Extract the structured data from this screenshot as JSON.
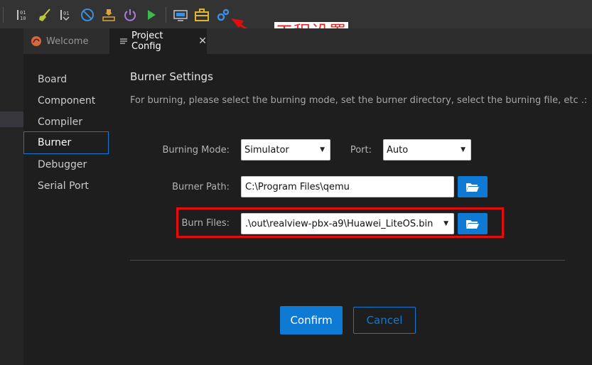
{
  "toolbar": {
    "items": [
      {
        "name": "build-icon"
      },
      {
        "name": "clean-icon"
      },
      {
        "name": "rebuild-icon"
      },
      {
        "name": "stop-icon"
      },
      {
        "name": "burn-icon"
      },
      {
        "name": "power-icon"
      },
      {
        "name": "run-icon"
      },
      {
        "name": "monitor-icon"
      },
      {
        "name": "toolbox-icon"
      },
      {
        "name": "project-settings-icon"
      }
    ]
  },
  "annotation": {
    "text": "工程设置",
    "color": "#e8211f"
  },
  "tabs": {
    "welcome_label": "Welcome",
    "config_label": "Project Config",
    "close_glyph": "✕"
  },
  "nav": {
    "items": [
      {
        "label": "Board",
        "active": false
      },
      {
        "label": "Component",
        "active": false
      },
      {
        "label": "Compiler",
        "active": false
      },
      {
        "label": "Burner",
        "active": true
      },
      {
        "label": "Debugger",
        "active": false
      },
      {
        "label": "Serial Port",
        "active": false
      }
    ]
  },
  "burner": {
    "title": "Burner Settings",
    "description": "For burning, please select the burning mode, set the burner directory, select the burning file, etc .:",
    "mode_label": "Burning Mode:",
    "mode_value": "Simulator",
    "port_label": "Port:",
    "port_value": "Auto",
    "path_label": "Burner Path:",
    "path_value": "C:\\Program Files\\qemu",
    "files_label": "Burn Files:",
    "files_value": ".\\out\\realview-pbx-a9\\Huawei_LiteOS.bin"
  },
  "actions": {
    "confirm_label": "Confirm",
    "cancel_label": "Cancel"
  },
  "colors": {
    "accent": "#0e7ad4",
    "highlight": "#e30d0d",
    "editor_bg": "#1e1e1e"
  }
}
